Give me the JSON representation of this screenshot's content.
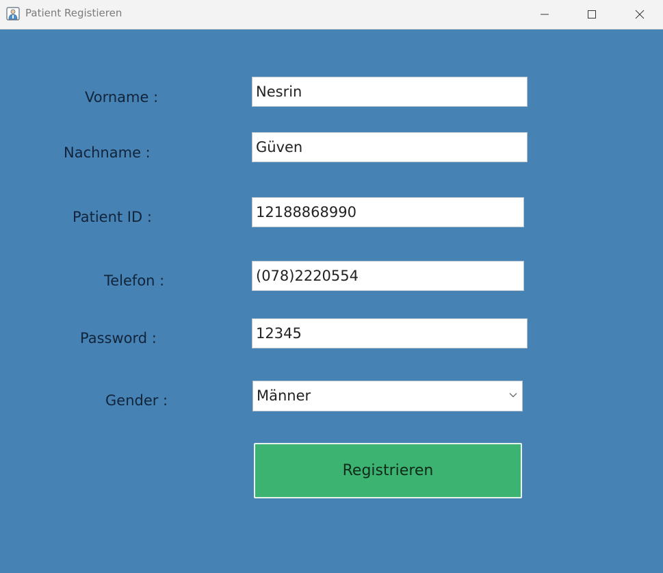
{
  "window": {
    "title": "Patient Registieren",
    "icons": {
      "app": "doctor-app-icon",
      "minimize": "minimize-icon",
      "maximize": "maximize-icon",
      "close": "close-icon"
    }
  },
  "form": {
    "vorname_label": "Vorname :",
    "vorname_value": "Nesrin",
    "nachname_label": "Nachname :",
    "nachname_value": "Güven",
    "patient_id_label": "Patient ID :",
    "patient_id_value": "12188868990",
    "telefon_label": "Telefon :",
    "telefon_value": "(078)2220554",
    "password_label": "Password :",
    "password_value": "12345",
    "gender_label": "Gender :",
    "gender_value": "Männer",
    "submit_label": "Registrieren"
  },
  "colors": {
    "background": "#4682b4",
    "button": "#3cb371",
    "titlebar": "#f3f3f3"
  }
}
